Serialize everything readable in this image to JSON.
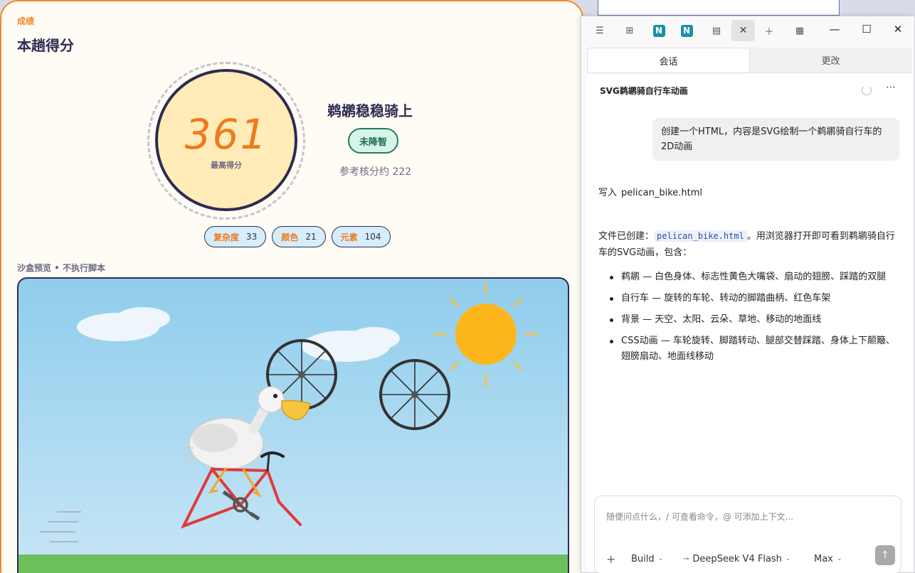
{
  "game": {
    "section_tag": "成绩",
    "heading": "本趟得分",
    "score": "361",
    "score_caption": "最高得分",
    "verdict": "鹈鹕稳稳骑上",
    "badge": "未降智",
    "ref_score": "参考核分约 222",
    "stats": [
      {
        "label": "复杂度",
        "value": "33"
      },
      {
        "label": "颜色",
        "value": "21"
      },
      {
        "label": "元素",
        "value": "104"
      }
    ],
    "sandbox_label": "沙盒预览 • 不执行脚本"
  },
  "chat": {
    "tabs": [
      "会话",
      "更改"
    ],
    "conversation_title": "SVG鹈鹕骑自行车动画",
    "user_message": "创建一个HTML，内容是SVG绘制一个鹈鹕骑自行车的2D动画",
    "write_prefix": "写入",
    "write_file": "pelican_bike.html",
    "reply_prefix": "文件已创建：",
    "reply_code": "pelican_bike.html",
    "reply_suffix": "。用浏览器打开即可看到鹈鹕骑自行车的SVG动画，包含：",
    "bullets": [
      "鹈鹕 — 白色身体、标志性黄色大嘴袋、扇动的翅膀、踩踏的双腿",
      "自行车 — 旋转的车轮、转动的脚踏曲柄、红色车架",
      "背景 — 天空、太阳、云朵、草地、移动的地面线",
      "CSS动画 — 车轮旋转、脚踏转动、腿部交替踩踏、身体上下颠簸、翅膀扇动、地面线移动"
    ],
    "composer_placeholder": "随便问点什么，/ 可查看命令，@ 可添加上下文...",
    "composer_add": "+",
    "composer_mode": "Build",
    "composer_model": "DeepSeek V4 Flash",
    "composer_effort": "Max"
  },
  "colors": {
    "accent_orange": "#f08a24",
    "navy": "#2e2b52",
    "badge_green": "#1f6b4e",
    "bike_red": "#e03a3a"
  }
}
